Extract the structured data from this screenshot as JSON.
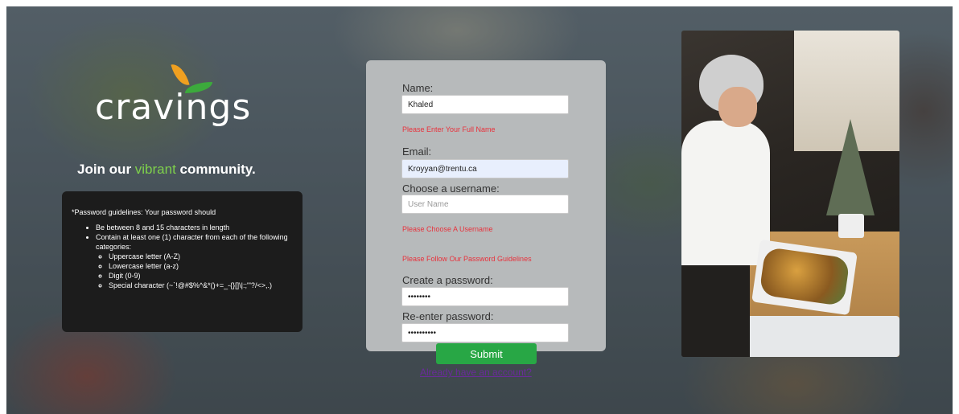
{
  "brand": {
    "name": "cravings"
  },
  "tagline": {
    "before": "Join our ",
    "highlight": "vibrant",
    "after": " community."
  },
  "guidelines": {
    "intro": "*Password guidelines: Your password should",
    "rules": [
      "Be between 8 and 15 characters in length",
      "Contain at least one (1) character from each of the following categories:"
    ],
    "categories": [
      "Uppercase letter (A-Z)",
      "Lowercase letter (a-z)",
      "Digit (0-9)",
      "Special character (~`!@#$%^&*()+=_-{}[]\\|:;\"'?/<>,.)"
    ]
  },
  "form": {
    "name_label": "Name:",
    "name_value": "Khaled",
    "name_error": "Please Enter Your Full Name",
    "email_label": "Email:",
    "email_value": "Kroyyan@trentu.ca",
    "username_label": "Choose a username:",
    "username_placeholder": "User Name",
    "username_error": "Please Choose A Username",
    "password_error": "Please Follow Our Password Guidelines",
    "password_label": "Create a password:",
    "password_value": "••••••••",
    "repassword_label": "Re-enter password:",
    "repassword_value": "••••••••••",
    "submit_label": "Submit",
    "login_link": "Already have an account?"
  },
  "colors": {
    "accent_green": "#28a745",
    "highlight_green": "#7ed04b",
    "error_red": "#e8323c",
    "link_purple": "#6a2b9a"
  }
}
